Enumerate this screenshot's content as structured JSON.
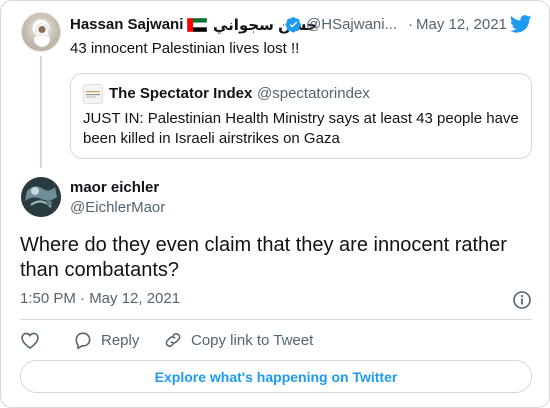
{
  "tweet": {
    "author_name": "Hassan Sajwani",
    "flag": "🇦🇪",
    "arabic_name": "حسن سجواني",
    "handle": "@HSajwani...",
    "separator": "·",
    "date": "May 12, 2021",
    "text": "43 innocent Palestinian lives lost !!",
    "verified": true
  },
  "quote": {
    "author_name": "The Spectator Index",
    "handle": "@spectatorindex",
    "text": "JUST IN: Palestinian Health Ministry says at least 43 people have been killed in Israeli airstrikes on Gaza"
  },
  "reply": {
    "author_name": "maor eichler",
    "handle": "@EichlerMaor",
    "text": "Where do they even claim that they are innocent rather than combatants?",
    "time": "1:50 PM · May 12, 2021"
  },
  "actions": {
    "reply_label": "Reply",
    "copy_label": "Copy link to Tweet"
  },
  "explore_label": "Explore what's happening on Twitter",
  "colors": {
    "accent": "#1d9bf0",
    "muted": "#536471",
    "border": "#cfd9de",
    "flag_green": "#00732f",
    "flag_red": "#ff0000"
  },
  "icons": [
    "twitter-bird-icon",
    "verified-badge-icon",
    "heart-icon",
    "reply-icon",
    "link-icon",
    "info-icon"
  ]
}
